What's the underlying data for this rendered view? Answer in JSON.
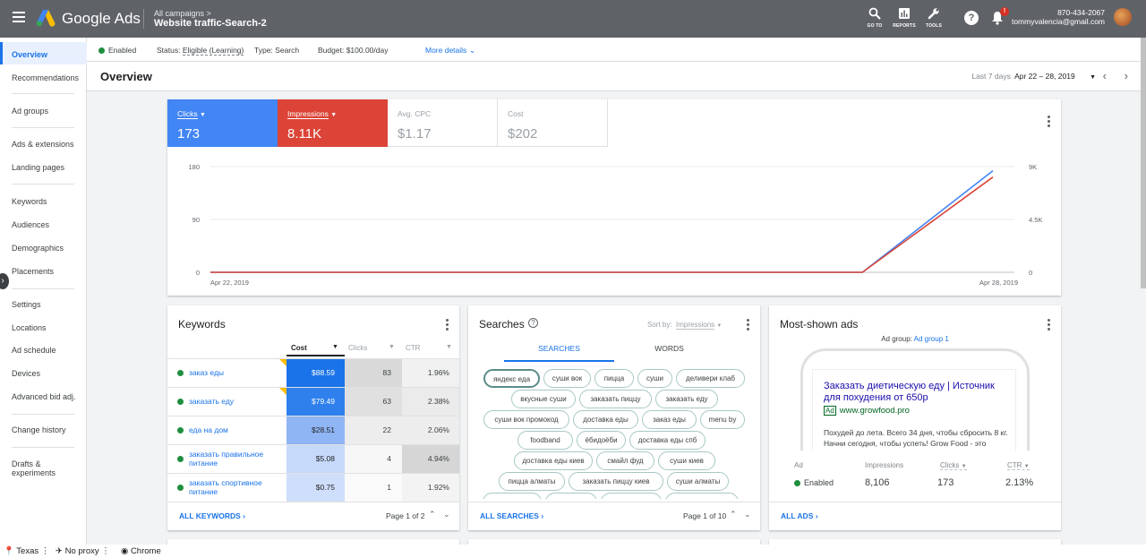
{
  "app": {
    "name": "Google Ads",
    "breadcrumb_sub": "All campaigns",
    "breadcrumb_main": "Website traffic-Search-2"
  },
  "topbar": {
    "goto": "GO TO",
    "reports": "REPORTS",
    "tools": "TOOLS",
    "notif_count": "!",
    "phone": "870-434-2067",
    "email": "tommyvalencia@gmail.com"
  },
  "sidebar": {
    "items": [
      "Overview",
      "Recommendations",
      "Ad groups",
      "Ads & extensions",
      "Landing pages",
      "Keywords",
      "Audiences",
      "Demographics",
      "Placements",
      "Settings",
      "Locations",
      "Ad schedule",
      "Devices",
      "Advanced bid adj.",
      "Change history",
      "Drafts & experiments"
    ]
  },
  "status": {
    "enabled": "Enabled",
    "status_label": "Status:",
    "status_value": "Eligible (Learning)",
    "type_label": "Type:",
    "type_value": "Search",
    "budget_label": "Budget:",
    "budget_value": "$100.00/day",
    "more": "More details"
  },
  "overview": {
    "title": "Overview",
    "range_label": "Last 7 days",
    "range_value": "Apr 22 – 28, 2019"
  },
  "metrics": [
    {
      "label": "Clicks",
      "value": "173",
      "color": "#4285f4"
    },
    {
      "label": "Impressions",
      "value": "8.11K",
      "color": "#db4437"
    },
    {
      "label": "Avg. CPC",
      "value": "$1.17"
    },
    {
      "label": "Cost",
      "value": "$202"
    }
  ],
  "chart_data": {
    "type": "line",
    "x": [
      "Apr 22, 2019",
      "Apr 23, 2019",
      "Apr 24, 2019",
      "Apr 25, 2019",
      "Apr 26, 2019",
      "Apr 27, 2019",
      "Apr 28, 2019"
    ],
    "xtick_labels": [
      "Apr 22, 2019",
      "Apr 28, 2019"
    ],
    "left_ticks": [
      "180",
      "90",
      "0"
    ],
    "right_ticks": [
      "9K",
      "4.5K",
      "0"
    ],
    "ylim_left": [
      0,
      180
    ],
    "ylim_right": [
      0,
      9000
    ],
    "series": [
      {
        "name": "Clicks",
        "axis": "left",
        "color": "#4285f4",
        "values": [
          0,
          0,
          0,
          0,
          0,
          0,
          173
        ]
      },
      {
        "name": "Impressions",
        "axis": "right",
        "color": "#db4437",
        "values": [
          0,
          0,
          0,
          0,
          0,
          0,
          8106
        ]
      }
    ],
    "grid": true
  },
  "keywords": {
    "title": "Keywords",
    "headers": [
      "Cost",
      "Clicks",
      "CTR"
    ],
    "rows": [
      {
        "name": "заказ еды",
        "cost": "$88.59",
        "clicks": "83",
        "ctr": "1.96%"
      },
      {
        "name": "заказать еду",
        "cost": "$79.49",
        "clicks": "63",
        "ctr": "2.38%"
      },
      {
        "name": "еда на дом",
        "cost": "$28.51",
        "clicks": "22",
        "ctr": "2.06%"
      },
      {
        "name": "заказать правильное питание",
        "cost": "$5.08",
        "clicks": "4",
        "ctr": "4.94%"
      },
      {
        "name": "заказать спортивное питание",
        "cost": "$0.75",
        "clicks": "1",
        "ctr": "1.92%"
      }
    ],
    "all_link": "ALL KEYWORDS",
    "page": "Page 1 of 2"
  },
  "searches": {
    "title": "Searches",
    "sort_label": "Sort by:",
    "sort_value": "Impressions",
    "tabs": [
      "SEARCHES",
      "WORDS"
    ],
    "chips": [
      "яндекс еда",
      "суши вок",
      "пицца",
      "суши",
      "деливери клаб",
      "вкусные суши",
      "заказать пиццу",
      "заказать еду",
      "суши вок промокод",
      "доставка еды",
      "заказ еды",
      "menu by",
      "foodband",
      "ёбидоёби",
      "доставка еды спб",
      "доставка еды киев",
      "смайл фуд",
      "суши киев",
      "пицца алматы",
      "заказать пиццу киев",
      "суши алматы"
    ],
    "all_link": "ALL SEARCHES",
    "page": "Page 1 of 10"
  },
  "ads": {
    "title": "Most-shown ads",
    "group_label": "Ad group:",
    "group_value": "Ad group 1",
    "headline": "Заказать диетическую еду | Источник для похудения от 650р",
    "ad_badge": "Ad",
    "url": "www.growfood.pro",
    "description": "Похудей до лета. Всего 34 дня, чтобы сбросить 8 кг. Начни сегодня, чтобы успеть! Grow Food - это сервис по доставке готового",
    "stat_labels": [
      "Ad",
      "Impressions",
      "Clicks",
      "CTR"
    ],
    "status": "Enabled",
    "impressions": "8,106",
    "clicks": "173",
    "ctr": "2.13%",
    "all_link": "ALL ADS"
  },
  "browser_status": {
    "location": "Texas",
    "proxy": "No proxy",
    "browser": "Chrome"
  }
}
